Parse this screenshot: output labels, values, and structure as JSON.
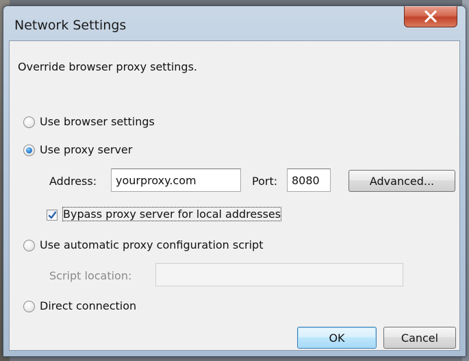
{
  "window": {
    "title": "Network Settings",
    "close_icon": "close-x-icon"
  },
  "description": "Override browser proxy settings.",
  "options": {
    "browser_settings_label": "Use browser settings",
    "proxy_server_label": "Use proxy server",
    "auto_config_label": "Use automatic proxy configuration script",
    "direct_label": "Direct connection",
    "selected": "proxy_server"
  },
  "proxy": {
    "address_label": "Address:",
    "address_value": "yourproxy.com",
    "port_label": "Port:",
    "port_value": "8080",
    "advanced_label": "Advanced...",
    "bypass_label": "Bypass proxy server for local addresses",
    "bypass_checked": true
  },
  "script": {
    "location_label": "Script location:",
    "location_value": ""
  },
  "footer": {
    "ok_label": "OK",
    "cancel_label": "Cancel"
  },
  "colors": {
    "accent": "#2a7fd0",
    "close_button": "#c3432a"
  }
}
